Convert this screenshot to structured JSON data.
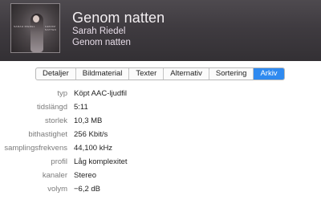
{
  "header": {
    "title": "Genom natten",
    "artist": "Sarah Riedel",
    "album": "Genom natten",
    "artwork": {
      "description_icon": "album-cover-art",
      "overlay_text_left": "SARAH RIEDEL",
      "overlay_text_right": "GENOM NATTEN"
    }
  },
  "tabs": [
    {
      "label": "Detaljer",
      "active": false
    },
    {
      "label": "Bildmaterial",
      "active": false
    },
    {
      "label": "Texter",
      "active": false
    },
    {
      "label": "Alternativ",
      "active": false
    },
    {
      "label": "Sortering",
      "active": false
    },
    {
      "label": "Arkiv",
      "active": true
    }
  ],
  "file_info": [
    {
      "label": "typ",
      "value": "Köpt AAC-ljudfil"
    },
    {
      "label": "tidslängd",
      "value": "5:11"
    },
    {
      "label": "storlek",
      "value": "10,3 MB"
    },
    {
      "label": "bithastighet",
      "value": "256 Kbit/s"
    },
    {
      "label": "samplingsfrekvens",
      "value": "44,100 kHz"
    },
    {
      "label": "profil",
      "value": "Låg komplexitet"
    },
    {
      "label": "kanaler",
      "value": "Stereo"
    },
    {
      "label": "volym",
      "value": "−6,2 dB"
    }
  ],
  "colors": {
    "header_bg": "#3f3b40",
    "active_tab": "#2f8af0",
    "label_gray": "#7b7b7b"
  }
}
